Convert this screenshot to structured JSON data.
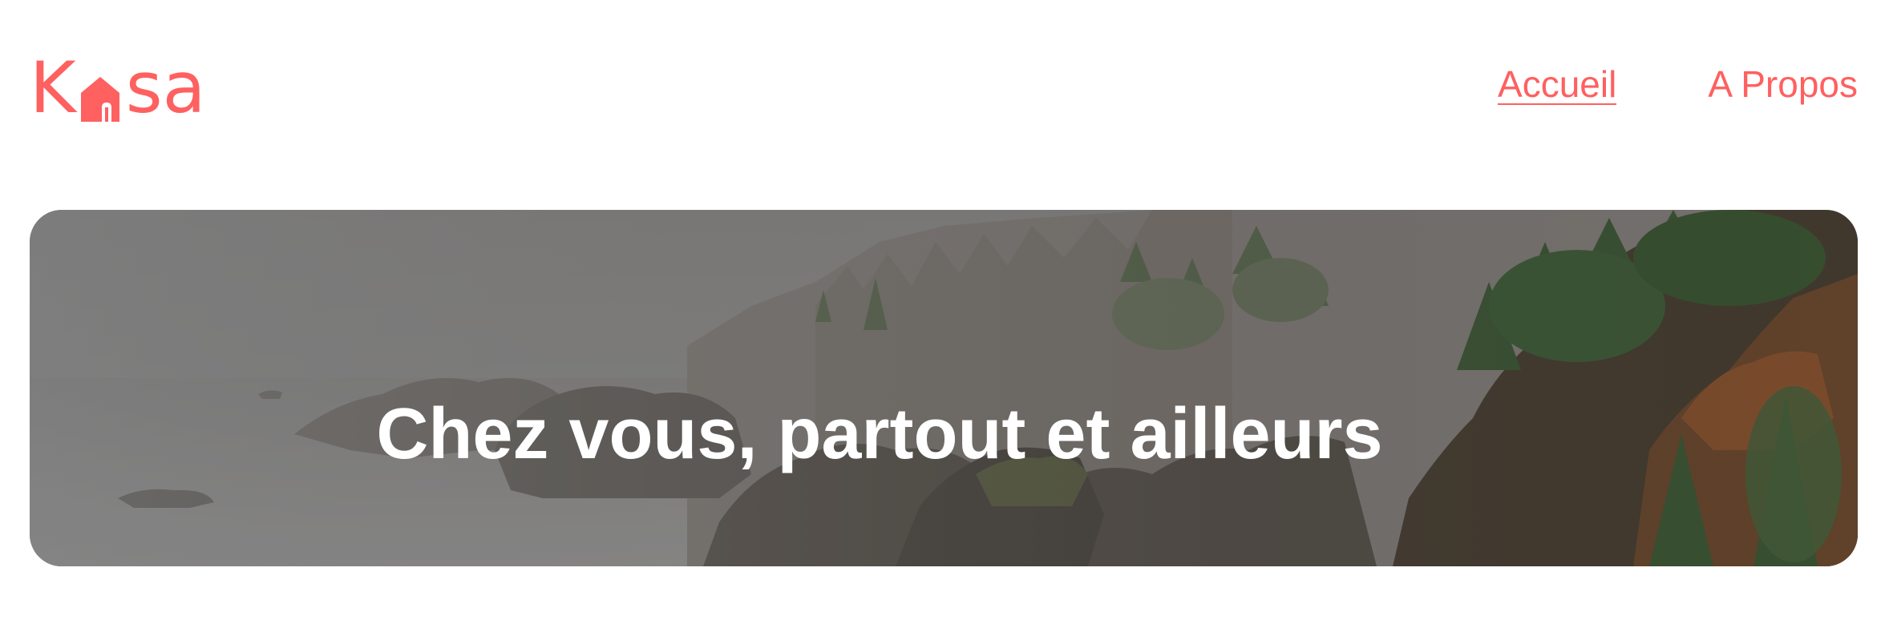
{
  "brand": {
    "name_part1": "K",
    "name_part2": "sa",
    "color": "#ff6060"
  },
  "nav": {
    "items": [
      {
        "label": "Accueil",
        "active": true
      },
      {
        "label": "A Propos",
        "active": false
      }
    ]
  },
  "hero": {
    "title": "Chez vous, partout et ailleurs",
    "image": "coastal-cliffs-with-trees"
  }
}
